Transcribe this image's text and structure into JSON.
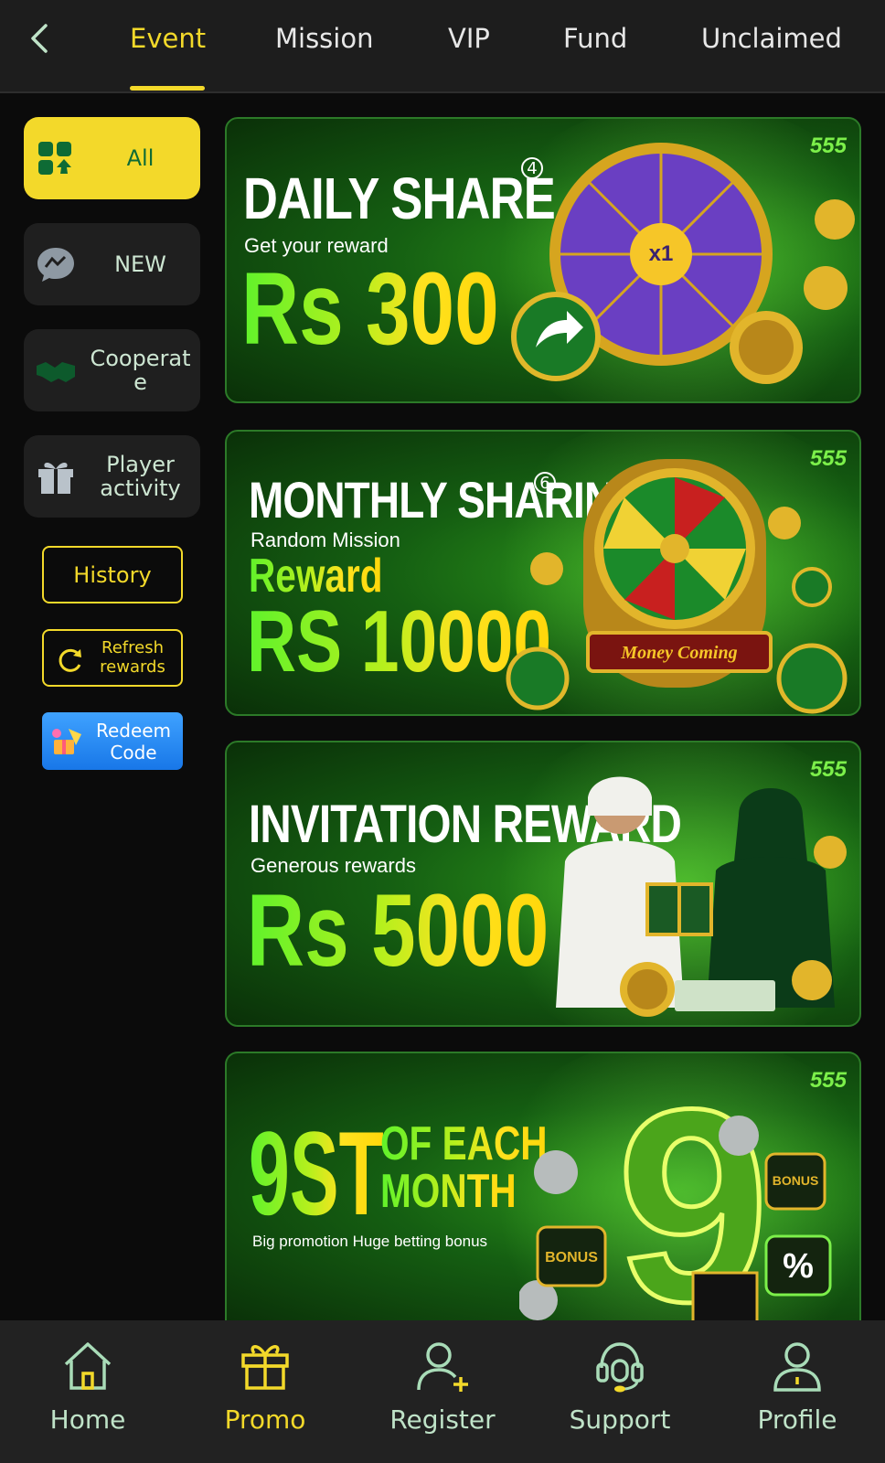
{
  "tabs": [
    "Event",
    "Mission",
    "VIP",
    "Fund",
    "Unclaimed"
  ],
  "sidebar": {
    "items": [
      {
        "label": "All"
      },
      {
        "label": "NEW"
      },
      {
        "label": "Cooperat e"
      },
      {
        "label": "Player activity"
      }
    ],
    "history_label": "History",
    "refresh_label": "Refresh rewards",
    "redeem_label": "Redeem Code"
  },
  "banners": [
    {
      "title": "DAILY SHARE",
      "subtitle": "Get your reward",
      "amount": "Rs 300",
      "badge": "4",
      "logo": "555"
    },
    {
      "title": "MONTHLY SHARING",
      "subtitle": "Random Mission",
      "reward_label": "Reward",
      "amount": "RS 10000",
      "badge": "6",
      "wheel_sign": "Money Coming",
      "logo": "555"
    },
    {
      "title": "INVITATION REWARD",
      "subtitle": "Generous rewards",
      "amount": "Rs 5000",
      "logo": "555"
    },
    {
      "title_big": "9ST",
      "title_small1": "OF EACH",
      "title_small2": "MONTH",
      "subtitle": "Big promotion Huge betting bonus",
      "logo": "555",
      "badge1": "BONUS",
      "badge2": "BONUS",
      "badge3": "%"
    }
  ],
  "bottom_nav": [
    {
      "label": "Home",
      "icon": "home-icon"
    },
    {
      "label": "Promo",
      "icon": "gift-icon"
    },
    {
      "label": "Register",
      "icon": "add-user-icon"
    },
    {
      "label": "Support",
      "icon": "headset-icon"
    },
    {
      "label": "Profile",
      "icon": "profile-icon"
    }
  ],
  "colors": {
    "accent": "#f3d92a",
    "nav_text": "#bfe3c8",
    "banner_green": "#155f12"
  }
}
